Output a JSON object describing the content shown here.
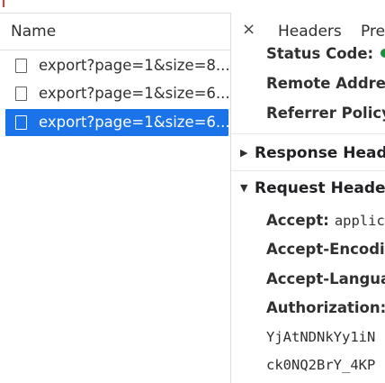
{
  "network_list": {
    "column_header": "Name",
    "requests": [
      {
        "label": "export?page=1&size=8..."
      },
      {
        "label": "export?page=1&size=6..."
      },
      {
        "label": "export?page=1&size=6..."
      }
    ],
    "selected_index": 2,
    "selected_color": "#1a73e8"
  },
  "details": {
    "tabs": {
      "close_symbol": "×",
      "headers": "Headers",
      "preview": "Pre"
    },
    "general": {
      "status_code_label": "Status Code:",
      "status_color": "#1e8e3e",
      "remote_address_label": "Remote Address",
      "referrer_policy_label": "Referrer Policy:"
    },
    "response_headers": {
      "title": "Response Header",
      "arrow": "▶"
    },
    "request_headers": {
      "title": "Request Headers",
      "arrow": "▼",
      "accept_label": "Accept:",
      "accept_value": "applic",
      "accept_encoding_label": "Accept-Encodin",
      "accept_language_label": "Accept-Languag",
      "authorization_label": "Authorization:",
      "authorization_line_1": "YjAtNDNkYy1iN",
      "authorization_line_2": "ck0NQ2BrY_4KP"
    }
  }
}
